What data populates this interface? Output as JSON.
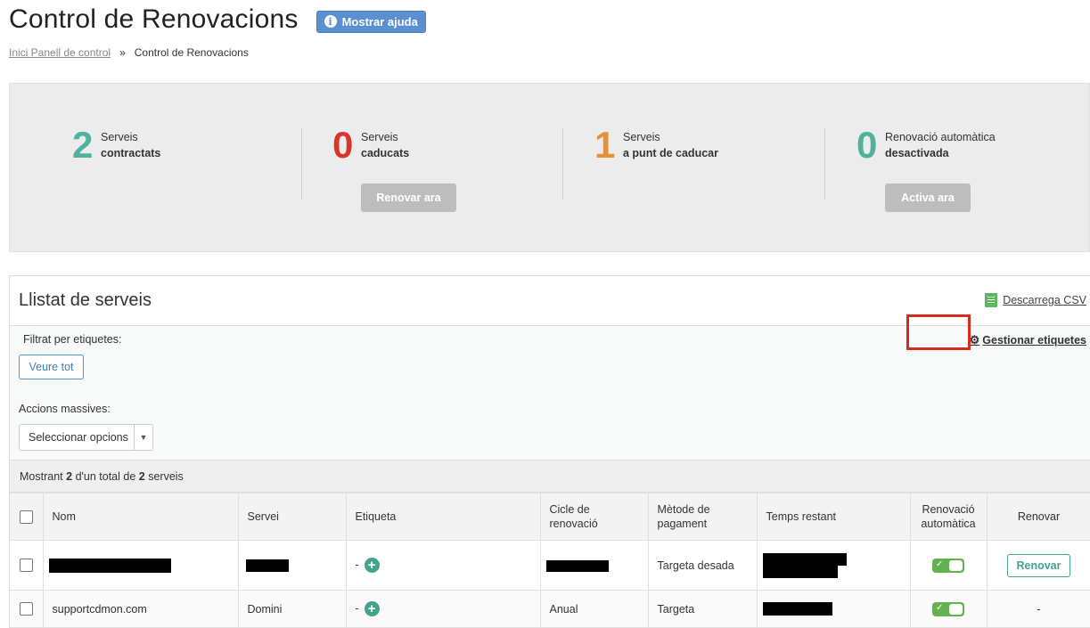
{
  "header": {
    "title": "Control de Renovacions",
    "help_label": "Mostrar ajuda",
    "help_icon": "info-icon"
  },
  "breadcrumb": {
    "home": "Inici Panell de control",
    "separator": "»",
    "current": "Control de Renovacions"
  },
  "stats": [
    {
      "value": "2",
      "line1": "Serveis",
      "line2": "contractats",
      "color": "#4fb29a"
    },
    {
      "value": "0",
      "line1": "Serveis",
      "line2": "caducats",
      "color": "#d9362b",
      "button": "Renovar ara"
    },
    {
      "value": "1",
      "line1": "Serveis",
      "line2": "a punt de caducar",
      "color": "#e5913a"
    },
    {
      "value": "0",
      "line1": "Renovació automàtica",
      "line2": "desactivada",
      "color": "#4fb29a",
      "button": "Activa ara"
    }
  ],
  "services_panel": {
    "title": "Llistat de serveis",
    "csv_label": "Descarrega CSV",
    "filter_label": "Filtrat per etiquetes:",
    "manage_tags_label": "Gestionar etiquetes",
    "view_all_label": "Veure tot",
    "bulk_actions_label": "Accions massives:",
    "bulk_select_value": "Seleccionar opcions"
  },
  "count": {
    "prefix": "Mostrant",
    "shown": "2",
    "middle": "d'un total de",
    "total": "2",
    "suffix": "serveis"
  },
  "table": {
    "headers": {
      "name": "Nom",
      "service": "Servei",
      "tag": "Etiqueta",
      "cycle": "Cicle de renovació",
      "payment": "Mètode de pagament",
      "remaining": "Temps restant",
      "auto": "Renovació automàtica",
      "renew": "Renovar"
    },
    "rows": [
      {
        "name": "",
        "service": "",
        "tag": "-",
        "cycle": "",
        "payment": "Targeta desada",
        "remaining": "",
        "auto": true,
        "renew": "Renovar"
      },
      {
        "name": "supportcdmon.com",
        "service": "Domini",
        "tag": "-",
        "cycle": "Anual",
        "payment": "Targeta",
        "remaining": "",
        "auto": true,
        "renew": "-"
      }
    ]
  },
  "colors": {
    "accent_green": "#43a38b",
    "toggle_green": "#62b34f",
    "highlight_red": "#d62c1a",
    "help_blue": "#5b8fd0"
  }
}
